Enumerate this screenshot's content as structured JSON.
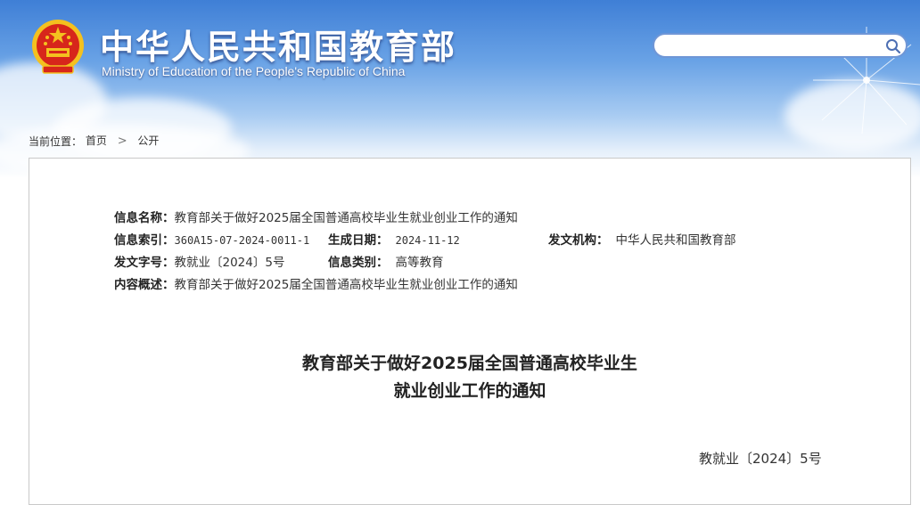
{
  "header": {
    "site_title": "中华人民共和国教育部",
    "site_subtitle": "Ministry of Education of the People's Republic of China",
    "search": {
      "value": "",
      "placeholder": ""
    }
  },
  "breadcrumb": {
    "prefix": "当前位置：",
    "items": [
      "首页",
      "公开"
    ],
    "separator": ">"
  },
  "meta": {
    "info_name_label": "信息名称：",
    "info_name_value": "教育部关于做好2025届全国普通高校毕业生就业创业工作的通知",
    "index_label": "信息索引：",
    "index_value": "360A15-07-2024-0011-1",
    "date_label": "生成日期：",
    "date_value": "2024-11-12",
    "issuer_label": "发文机构：",
    "issuer_value": "中华人民共和国教育部",
    "doc_no_label": "发文字号：",
    "doc_no_value": "教就业〔2024〕5号",
    "category_label": "信息类别：",
    "category_value": "高等教育",
    "summary_label": "内容概述：",
    "summary_value": "教育部关于做好2025届全国普通高校毕业生就业创业工作的通知"
  },
  "document": {
    "title_line1": "教育部关于做好2025届全国普通高校毕业生",
    "title_line2": "就业创业工作的通知",
    "number": "教就业〔2024〕5号"
  },
  "colors": {
    "banner_top": "#3f7fd6",
    "banner_bottom": "#e6f0fb",
    "emblem_red": "#d7261b",
    "emblem_gold": "#f4c11f",
    "search_border": "#6f96d6"
  }
}
